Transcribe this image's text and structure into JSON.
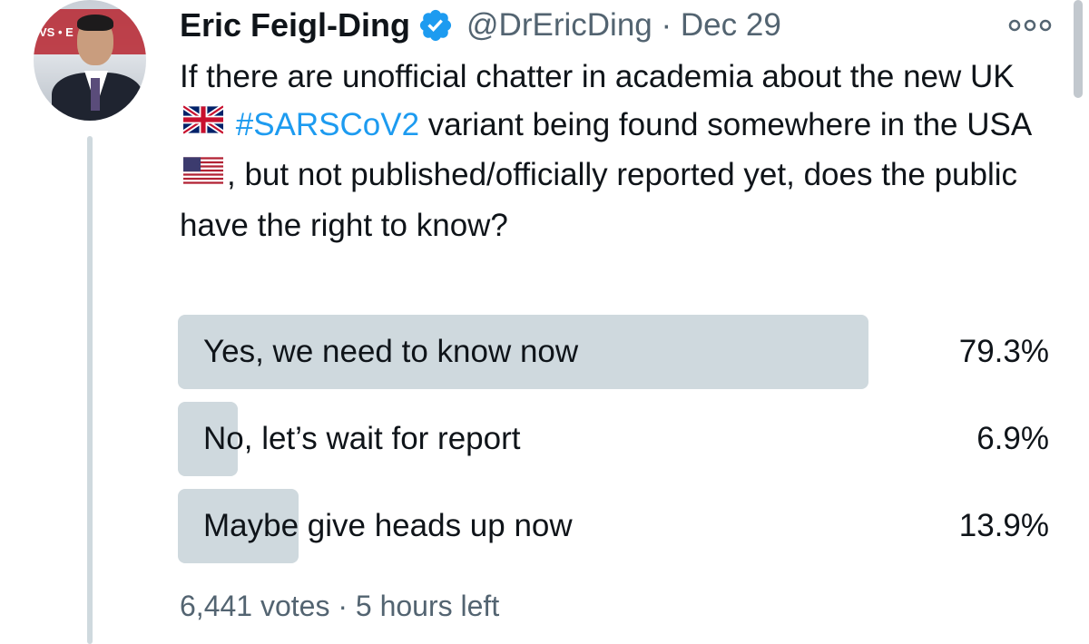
{
  "tweet": {
    "author_name": "Eric Feigl-Ding",
    "handle": "@DrEricDing",
    "separator": "·",
    "date": "Dec 29",
    "text": {
      "part1": "If there are unofficial chatter in academia about the new UK",
      "hashtag": "#SARSCoV2",
      "part2": "variant being found somewhere in the USA",
      "part3": ", but not published/officially reported yet, does the public have the right to know?"
    },
    "avatar_logo_text": "VS • E"
  },
  "poll": {
    "options": [
      {
        "label": "Yes, we need to know now",
        "percent_text": "79.3%",
        "percent": 79.3
      },
      {
        "label": "No, let’s wait for report",
        "percent_text": "6.9%",
        "percent": 6.9
      },
      {
        "label": "Maybe give heads up now",
        "percent_text": "13.9%",
        "percent": 13.9
      }
    ],
    "votes": "6,441 votes",
    "separator": "·",
    "time_left": "5 hours left"
  },
  "colors": {
    "accent": "#1d9bf0",
    "poll_fill": "#cfd9de",
    "secondary_text": "#536471"
  },
  "icons": [
    "avatar",
    "verified-badge-icon",
    "more-options-icon",
    "uk-flag-icon",
    "us-flag-icon"
  ]
}
